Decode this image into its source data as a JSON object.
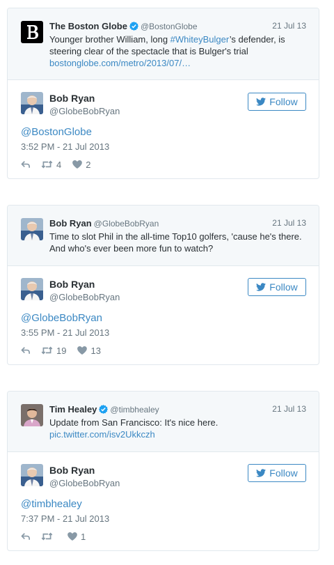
{
  "colors": {
    "link": "#3b88c3",
    "muted": "#66757f",
    "icon": "#8899a6",
    "border": "#e1e8ed"
  },
  "cards": [
    {
      "quoted": {
        "name": "The Boston Globe",
        "verified": true,
        "handle": "@BostonGlobe",
        "date": "21 Jul 13",
        "text_before": "Younger brother William, long ",
        "hashtag": "#WhiteyBulger",
        "text_after": "’s defender, is steering clear of the spectacle that is Bulger's trial",
        "link": "bostonglobe.com/metro/2013/07/…",
        "avatar_icon": "boston-globe-logo"
      },
      "author": {
        "name": "Bob Ryan",
        "handle": "@GlobeBobRyan"
      },
      "follow_label": "Follow",
      "mention": "@BostonGlobe",
      "timestamp": "3:52 PM - 21 Jul 2013",
      "retweets": "4",
      "likes": "2"
    },
    {
      "quoted": {
        "name": "Bob Ryan",
        "verified": false,
        "handle": "@GlobeBobRyan",
        "date": "21 Jul 13",
        "text": "Time to slot Phil in the all-time Top10 golfers, 'cause he's there. And who's ever been more fun to watch?"
      },
      "author": {
        "name": "Bob Ryan",
        "handle": "@GlobeBobRyan"
      },
      "follow_label": "Follow",
      "mention": "@GlobeBobRyan",
      "timestamp": "3:55 PM - 21 Jul 2013",
      "retweets": "19",
      "likes": "13"
    },
    {
      "quoted": {
        "name": "Tim Healey",
        "verified": true,
        "handle": "@timbhealey",
        "date": "21 Jul 13",
        "text": "Update from San Francisco: It's nice here.",
        "link": "pic.twitter.com/isv2Ukkczh"
      },
      "author": {
        "name": "Bob Ryan",
        "handle": "@GlobeBobRyan"
      },
      "follow_label": "Follow",
      "mention": "@timbhealey",
      "timestamp": "7:37 PM - 21 Jul 2013",
      "retweets": "",
      "likes": "1"
    }
  ]
}
